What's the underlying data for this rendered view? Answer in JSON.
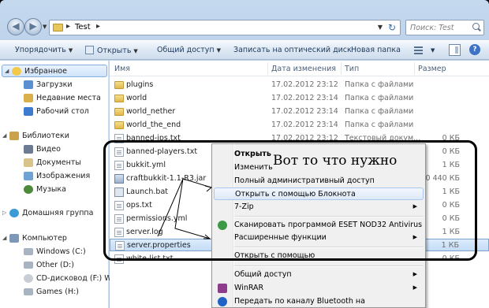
{
  "window": {
    "path": "Test",
    "search_placeholder": "Поиск: Test"
  },
  "toolbar": {
    "organize": "Упорядочить",
    "open": "Открыть",
    "share": "Общий доступ",
    "burn": "Записать на оптический диск",
    "new_folder": "Новая папка"
  },
  "navpane": {
    "items": [
      {
        "label": "Избранное",
        "icon": "star-icon"
      },
      {
        "label": "Загрузки",
        "icon": "downloads-icon"
      },
      {
        "label": "Недавние места",
        "icon": "recent-places-icon"
      },
      {
        "label": "Рабочий стол",
        "icon": "desktop-icon"
      },
      {
        "label": "Библиотеки",
        "icon": "libraries-icon"
      },
      {
        "label": "Видео",
        "icon": "video-icon"
      },
      {
        "label": "Документы",
        "icon": "documents-icon"
      },
      {
        "label": "Изображения",
        "icon": "pictures-icon"
      },
      {
        "label": "Музыка",
        "icon": "music-icon"
      },
      {
        "label": "Домашняя группа",
        "icon": "homegroup-icon"
      },
      {
        "label": "Компьютер",
        "icon": "computer-icon"
      },
      {
        "label": "Windows (C:)",
        "icon": "drive-icon"
      },
      {
        "label": "Other (D:)",
        "icon": "drive-icon"
      },
      {
        "label": "CD-дисковод (F:) W",
        "icon": "cd-drive-icon"
      },
      {
        "label": "Games (H:)",
        "icon": "drive-icon"
      }
    ]
  },
  "columns": {
    "name": "Имя",
    "date": "Дата изменения",
    "type": "Тип",
    "size": "Размер"
  },
  "files": [
    {
      "name": "plugins",
      "date": "17.02.2012 23:12",
      "type": "Папка с файлами",
      "size": ""
    },
    {
      "name": "world",
      "date": "17.02.2012 23:14",
      "type": "Папка с файлами",
      "size": ""
    },
    {
      "name": "world_nether",
      "date": "17.02.2012 23:14",
      "type": "Папка с файлами",
      "size": ""
    },
    {
      "name": "world_the_end",
      "date": "17.02.2012 23:14",
      "type": "Папка с файлами",
      "size": ""
    },
    {
      "name": "banned-ips.txt",
      "date": "17.02.2012 23:12",
      "type": "Текстовый докум...",
      "size": "0 КБ"
    },
    {
      "name": "banned-players.txt",
      "date": "",
      "type": "",
      "size": "0 КБ"
    },
    {
      "name": "bukkit.yml",
      "date": "",
      "type": "",
      "size": "1 КБ"
    },
    {
      "name": "craftbukkit-1.1-R3.jar",
      "date": "",
      "type": "",
      "size": "10 440 КБ"
    },
    {
      "name": "Launch.bat",
      "date": "",
      "type": "",
      "size": "1 КБ"
    },
    {
      "name": "ops.txt",
      "date": "",
      "type": "",
      "size": "0 КБ"
    },
    {
      "name": "permissions.yml",
      "date": "",
      "type": "",
      "size": "0 КБ"
    },
    {
      "name": "server.log",
      "date": "",
      "type": "",
      "size": "1 КБ"
    },
    {
      "name": "server.properties",
      "date": "",
      "type": "",
      "size": "1 КБ"
    },
    {
      "name": "white-list.txt",
      "date": "",
      "type": "",
      "size": "0 КБ"
    }
  ],
  "context_menu": {
    "open": "Открыть",
    "edit": "Изменить",
    "full_share": "Полный административный доступ",
    "open_notepad": "Открыть с помощью Блокнота",
    "zip": "7-Zip",
    "eset": "Сканировать программой ESET NOD32 Antivirus",
    "advanced": "Расширенные функции",
    "open_with": "Открыть с помощью",
    "share": "Общий доступ",
    "winrar": "WinRAR",
    "bluetooth": "Передать по каналу Bluetooth на"
  },
  "annotation": {
    "text": "Вот то что нужно"
  },
  "colors": {
    "accent": "#3d72c6",
    "selection": "#c3dcf7",
    "annotation": "#000000"
  }
}
